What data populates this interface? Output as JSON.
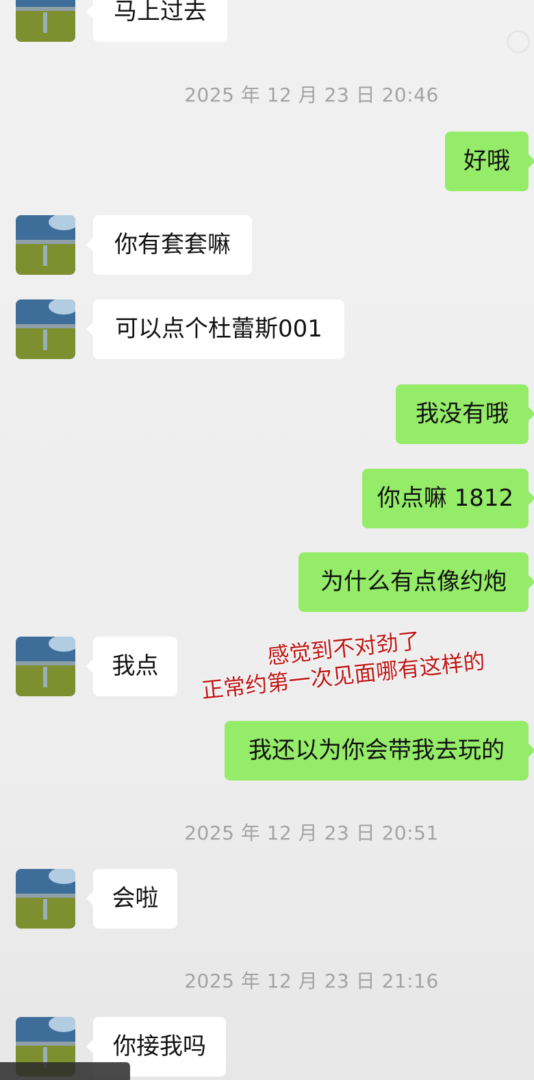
{
  "messages": {
    "m1": "马上过去",
    "m2": "好哦",
    "m3": "你有套套嘛",
    "m4": "可以点个杜蕾斯001",
    "m5": "我没有哦",
    "m6": "你点嘛 1812",
    "m7": "为什么有点像约炮",
    "m8": "我点",
    "m9": "我还以为你会带我去玩的",
    "m10": "会啦",
    "m11": "你接我吗"
  },
  "timestamps": {
    "t1": "2025 年 12 月 23 日  20:46",
    "t2": "2025 年 12 月 23 日  20:51",
    "t3": "2025 年 12 月 23 日  21:16"
  },
  "annotation": {
    "line1": "感觉到不对劲了",
    "line2": "正常约第一次见面哪有这样的",
    "color": "#c01818"
  },
  "colors": {
    "incoming_bubble": "#ffffff",
    "outgoing_bubble": "#95ec69",
    "background": "#ededed",
    "timestamp_text": "#a3a3a3"
  },
  "icons": {
    "avatar": "landscape-avatar-icon"
  }
}
